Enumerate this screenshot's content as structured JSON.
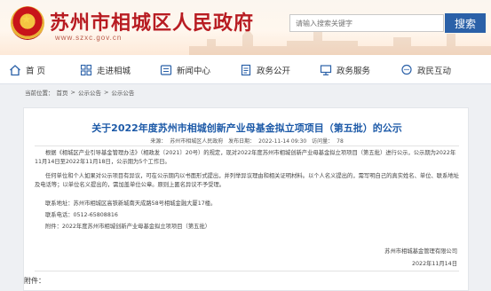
{
  "header": {
    "site_title": "苏州市相城区人民政府",
    "site_domain": "www.szxc.gov.cn",
    "search_placeholder": "请输入搜索关键字",
    "search_button": "搜索"
  },
  "nav": {
    "items": [
      {
        "label": "首 页",
        "icon": "home-icon"
      },
      {
        "label": "走进相城",
        "icon": "grid-icon"
      },
      {
        "label": "新闻中心",
        "icon": "news-icon"
      },
      {
        "label": "政务公开",
        "icon": "document-icon"
      },
      {
        "label": "政务服务",
        "icon": "monitor-icon"
      },
      {
        "label": "政民互动",
        "icon": "chat-icon"
      }
    ]
  },
  "breadcrumb": {
    "prefix": "当前位置：",
    "items": [
      "首页",
      "公示公告",
      "公示公告"
    ],
    "separator": ">"
  },
  "article": {
    "title": "关于2022年度苏州市相城创新产业母基金拟立项项目（第五批）的公示",
    "source_label": "来源：",
    "source": "苏州市相城区人民政府",
    "date_label": "发布日期：",
    "date": "2022-11-14 09:30",
    "views_label": "访问量：",
    "views": "78",
    "p1": "根据《相城区产业引导基金管理办法》（相政发〔2021〕20号）的规定，现对2022年度苏州市相城创新产业母基金拟立项项目（第五批）进行公示，公示期为2022年11月14日至2022年11月18日，公示期为5个工作日。",
    "p2": "任何单位和个人如果对公示项目有异议，可在公示期内以书面形式提出，并列举异议理由和相关证明材料。以个人名义提出的，需写明自己的真实姓名、单位、联系地址及电话等；以单位名义提出的，需加盖单位公章。原则上匿名异议不予受理。",
    "contact_unit": "联系地址：苏州市相城区高铁新城南天成路58号相城金融大厦17楼。",
    "contact_phone": "联系电话：0512-65808816",
    "attachment_line": "附件：2022年度苏州市相城创新产业母基金拟立项项目（第五批）",
    "signature_org": "苏州市相城基金管理有限公司",
    "signature_date": "2022年11月14日",
    "attachment_heading": "附件："
  },
  "colors": {
    "title_red": "#b81c22",
    "article_title_blue": "#1d5aa8",
    "search_button_blue": "#2b61a8"
  }
}
